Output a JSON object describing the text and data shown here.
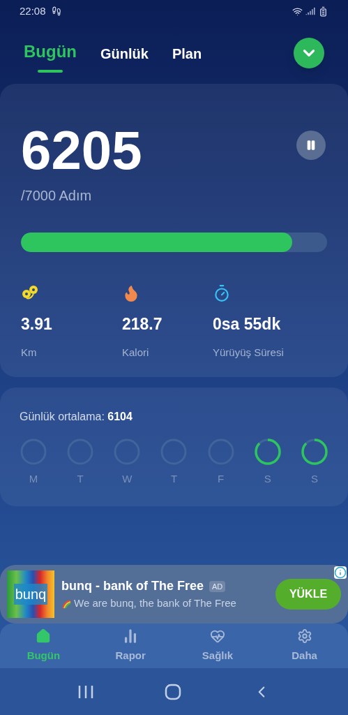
{
  "status_bar": {
    "time": "22:08"
  },
  "tabs": [
    {
      "label": "Bugün",
      "selected": true
    },
    {
      "label": "Günlük",
      "selected": false
    },
    {
      "label": "Plan",
      "selected": false
    }
  ],
  "today": {
    "steps": "6205",
    "goal": "/7000 Adım",
    "paused": false,
    "level": 0.887,
    "stats": [
      {
        "kind": "distance",
        "value": "3.91",
        "label": "Km"
      },
      {
        "kind": "calories",
        "value": "218.7",
        "label": "Kalori"
      },
      {
        "kind": "time",
        "value": "0sa 55dk",
        "label": "Yürüyüş Süresi"
      }
    ]
  },
  "average": {
    "text": "Günlük ortalama: **6104**",
    "days": [
      {
        "label": "M",
        "level": 0
      },
      {
        "label": "T",
        "level": 0
      },
      {
        "label": "W",
        "level": 0
      },
      {
        "label": "T",
        "level": 0
      },
      {
        "label": "F",
        "level": 0
      },
      {
        "label": "S",
        "level": 0.87
      },
      {
        "label": "S",
        "level": 0.87
      }
    ]
  },
  "ad": {
    "logo_text": "bunq",
    "title": "bunq - bank of The Free",
    "badge": "AD",
    "text": "We are bunq, the bank of The Free",
    "button": "YÜKLE"
  },
  "bottom_nav": [
    {
      "kind": "home",
      "label": "Bugün",
      "selected": true
    },
    {
      "kind": "report",
      "label": "Rapor",
      "selected": false
    },
    {
      "kind": "health",
      "label": "Sağlık",
      "selected": false
    },
    {
      "kind": "more",
      "label": "Daha",
      "selected": false
    }
  ]
}
